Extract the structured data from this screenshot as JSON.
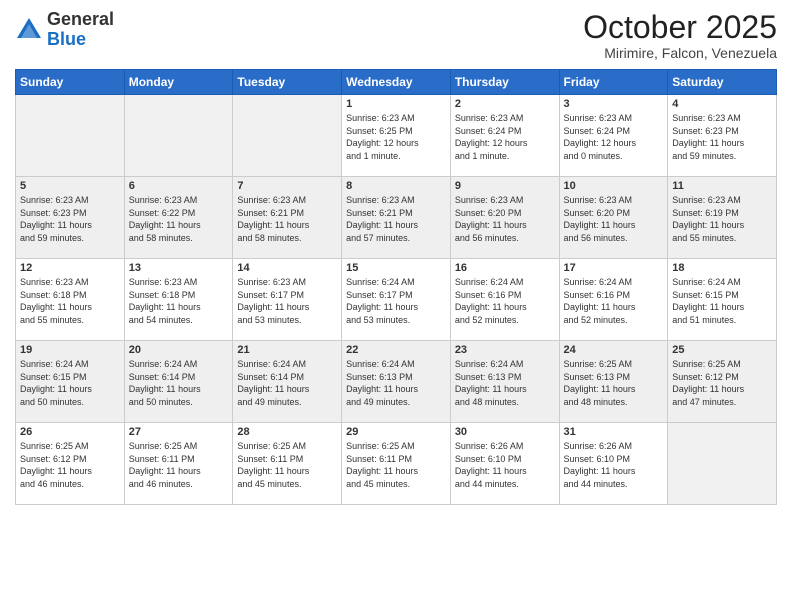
{
  "header": {
    "logo_general": "General",
    "logo_blue": "Blue",
    "month_title": "October 2025",
    "location": "Mirimire, Falcon, Venezuela"
  },
  "weekdays": [
    "Sunday",
    "Monday",
    "Tuesday",
    "Wednesday",
    "Thursday",
    "Friday",
    "Saturday"
  ],
  "weeks": [
    [
      {
        "day": "",
        "text": ""
      },
      {
        "day": "",
        "text": ""
      },
      {
        "day": "",
        "text": ""
      },
      {
        "day": "1",
        "text": "Sunrise: 6:23 AM\nSunset: 6:25 PM\nDaylight: 12 hours\nand 1 minute."
      },
      {
        "day": "2",
        "text": "Sunrise: 6:23 AM\nSunset: 6:24 PM\nDaylight: 12 hours\nand 1 minute."
      },
      {
        "day": "3",
        "text": "Sunrise: 6:23 AM\nSunset: 6:24 PM\nDaylight: 12 hours\nand 0 minutes."
      },
      {
        "day": "4",
        "text": "Sunrise: 6:23 AM\nSunset: 6:23 PM\nDaylight: 11 hours\nand 59 minutes."
      }
    ],
    [
      {
        "day": "5",
        "text": "Sunrise: 6:23 AM\nSunset: 6:23 PM\nDaylight: 11 hours\nand 59 minutes."
      },
      {
        "day": "6",
        "text": "Sunrise: 6:23 AM\nSunset: 6:22 PM\nDaylight: 11 hours\nand 58 minutes."
      },
      {
        "day": "7",
        "text": "Sunrise: 6:23 AM\nSunset: 6:21 PM\nDaylight: 11 hours\nand 58 minutes."
      },
      {
        "day": "8",
        "text": "Sunrise: 6:23 AM\nSunset: 6:21 PM\nDaylight: 11 hours\nand 57 minutes."
      },
      {
        "day": "9",
        "text": "Sunrise: 6:23 AM\nSunset: 6:20 PM\nDaylight: 11 hours\nand 56 minutes."
      },
      {
        "day": "10",
        "text": "Sunrise: 6:23 AM\nSunset: 6:20 PM\nDaylight: 11 hours\nand 56 minutes."
      },
      {
        "day": "11",
        "text": "Sunrise: 6:23 AM\nSunset: 6:19 PM\nDaylight: 11 hours\nand 55 minutes."
      }
    ],
    [
      {
        "day": "12",
        "text": "Sunrise: 6:23 AM\nSunset: 6:18 PM\nDaylight: 11 hours\nand 55 minutes."
      },
      {
        "day": "13",
        "text": "Sunrise: 6:23 AM\nSunset: 6:18 PM\nDaylight: 11 hours\nand 54 minutes."
      },
      {
        "day": "14",
        "text": "Sunrise: 6:23 AM\nSunset: 6:17 PM\nDaylight: 11 hours\nand 53 minutes."
      },
      {
        "day": "15",
        "text": "Sunrise: 6:24 AM\nSunset: 6:17 PM\nDaylight: 11 hours\nand 53 minutes."
      },
      {
        "day": "16",
        "text": "Sunrise: 6:24 AM\nSunset: 6:16 PM\nDaylight: 11 hours\nand 52 minutes."
      },
      {
        "day": "17",
        "text": "Sunrise: 6:24 AM\nSunset: 6:16 PM\nDaylight: 11 hours\nand 52 minutes."
      },
      {
        "day": "18",
        "text": "Sunrise: 6:24 AM\nSunset: 6:15 PM\nDaylight: 11 hours\nand 51 minutes."
      }
    ],
    [
      {
        "day": "19",
        "text": "Sunrise: 6:24 AM\nSunset: 6:15 PM\nDaylight: 11 hours\nand 50 minutes."
      },
      {
        "day": "20",
        "text": "Sunrise: 6:24 AM\nSunset: 6:14 PM\nDaylight: 11 hours\nand 50 minutes."
      },
      {
        "day": "21",
        "text": "Sunrise: 6:24 AM\nSunset: 6:14 PM\nDaylight: 11 hours\nand 49 minutes."
      },
      {
        "day": "22",
        "text": "Sunrise: 6:24 AM\nSunset: 6:13 PM\nDaylight: 11 hours\nand 49 minutes."
      },
      {
        "day": "23",
        "text": "Sunrise: 6:24 AM\nSunset: 6:13 PM\nDaylight: 11 hours\nand 48 minutes."
      },
      {
        "day": "24",
        "text": "Sunrise: 6:25 AM\nSunset: 6:13 PM\nDaylight: 11 hours\nand 48 minutes."
      },
      {
        "day": "25",
        "text": "Sunrise: 6:25 AM\nSunset: 6:12 PM\nDaylight: 11 hours\nand 47 minutes."
      }
    ],
    [
      {
        "day": "26",
        "text": "Sunrise: 6:25 AM\nSunset: 6:12 PM\nDaylight: 11 hours\nand 46 minutes."
      },
      {
        "day": "27",
        "text": "Sunrise: 6:25 AM\nSunset: 6:11 PM\nDaylight: 11 hours\nand 46 minutes."
      },
      {
        "day": "28",
        "text": "Sunrise: 6:25 AM\nSunset: 6:11 PM\nDaylight: 11 hours\nand 45 minutes."
      },
      {
        "day": "29",
        "text": "Sunrise: 6:25 AM\nSunset: 6:11 PM\nDaylight: 11 hours\nand 45 minutes."
      },
      {
        "day": "30",
        "text": "Sunrise: 6:26 AM\nSunset: 6:10 PM\nDaylight: 11 hours\nand 44 minutes."
      },
      {
        "day": "31",
        "text": "Sunrise: 6:26 AM\nSunset: 6:10 PM\nDaylight: 11 hours\nand 44 minutes."
      },
      {
        "day": "",
        "text": ""
      }
    ]
  ]
}
